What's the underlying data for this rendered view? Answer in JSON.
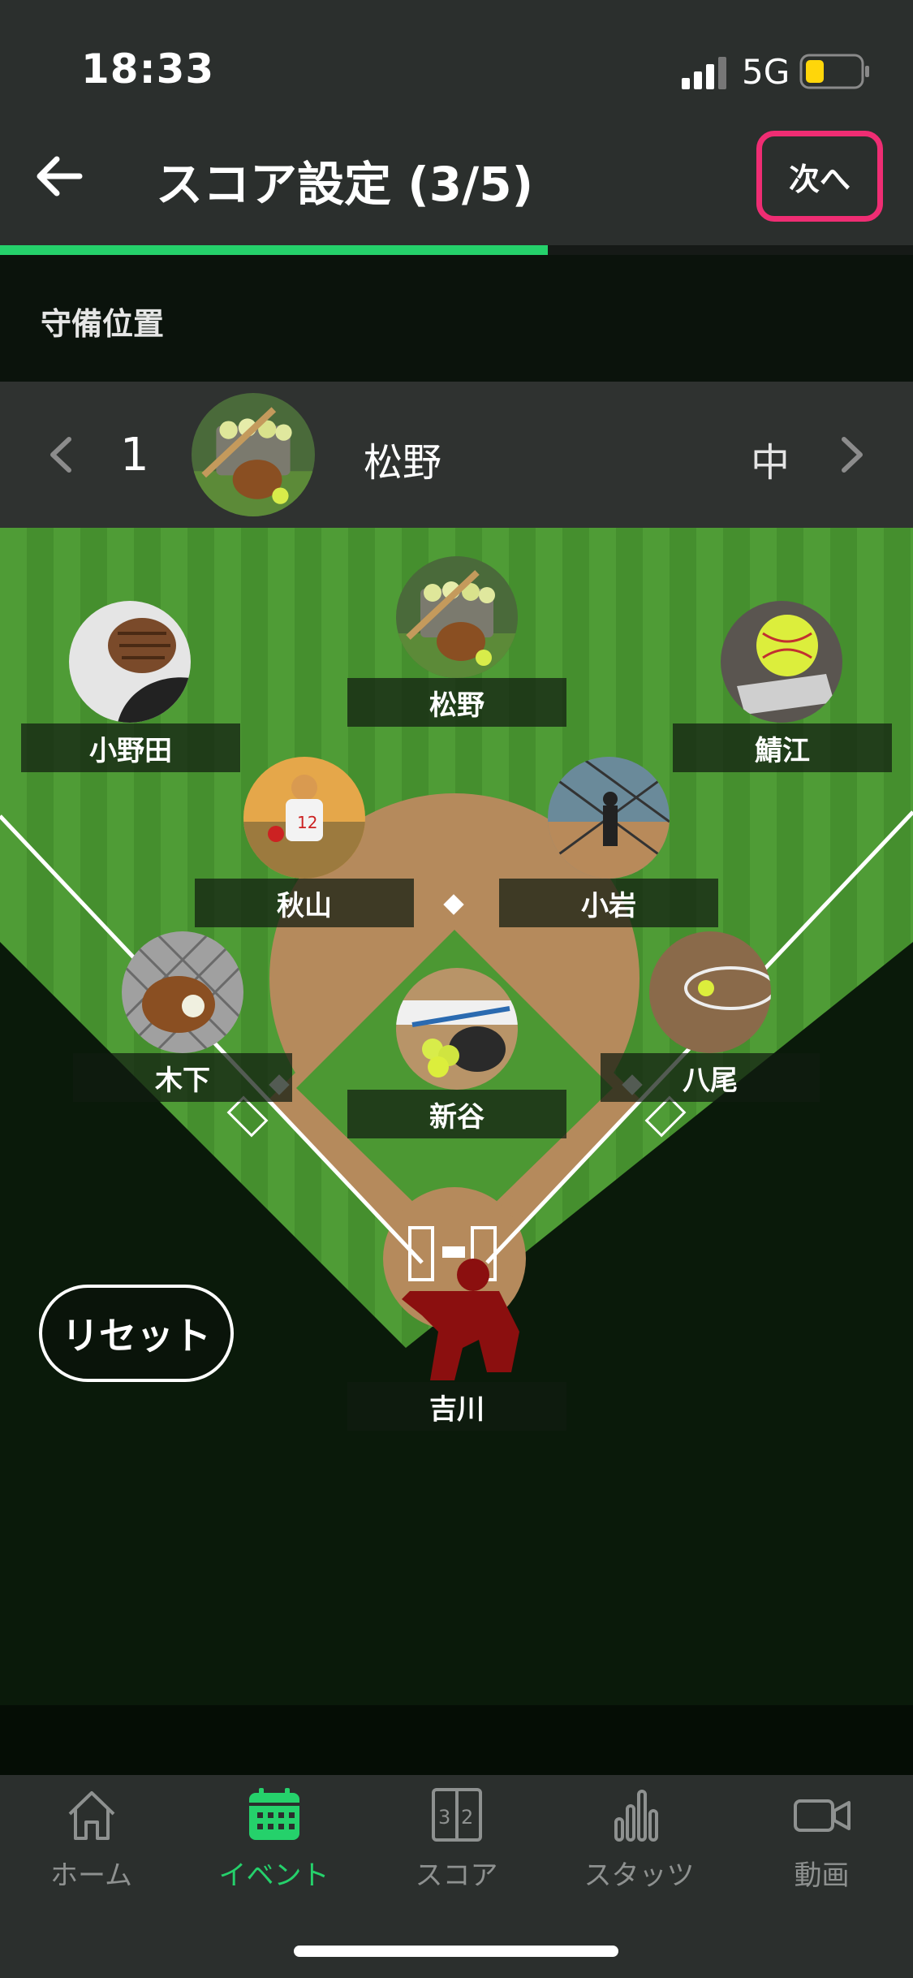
{
  "status_bar": {
    "time": "18:33",
    "network": "5G"
  },
  "header": {
    "title": "スコア設定 (3/5)",
    "next_label": "次へ",
    "progress_fraction": 0.6
  },
  "section": {
    "label": "守備位置"
  },
  "selector": {
    "batting_number": "1",
    "player_name": "松野",
    "position": "中"
  },
  "players": {
    "center": "松野",
    "left": "小野田",
    "right": "鯖江",
    "shortstop": "秋山",
    "second": "小岩",
    "third": "木下",
    "first": "八尾",
    "pitcher": "新谷",
    "catcher": "吉川"
  },
  "reset_label": "リセット",
  "tabs": [
    {
      "label": "ホーム",
      "icon": "home-icon",
      "active": false
    },
    {
      "label": "イベント",
      "icon": "calendar-icon",
      "active": true
    },
    {
      "label": "スコア",
      "icon": "scorebook-icon",
      "active": false
    },
    {
      "label": "スタッツ",
      "icon": "bar-chart-icon",
      "active": false
    },
    {
      "label": "動画",
      "icon": "video-camera-icon",
      "active": false
    }
  ],
  "colors": {
    "accent": "#25d16b",
    "highlight": "#ef2d73",
    "field_green": "#4d9a35",
    "dirt": "#b58a5c",
    "catcher": "#8b0f0f"
  }
}
